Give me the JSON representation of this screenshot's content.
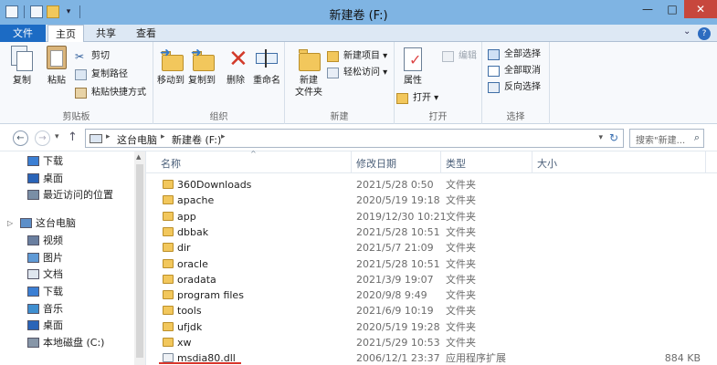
{
  "window": {
    "title": "新建卷 (F:)",
    "controls": {
      "minimize": "—",
      "maximize": "□",
      "close": "✕"
    }
  },
  "ribbon_tabs": [
    "文件",
    "主页",
    "共享",
    "查看"
  ],
  "ribbon": {
    "clipboard": {
      "label": "剪贴板",
      "copy": "复制",
      "paste": "粘贴",
      "cut": "剪切",
      "copy_path": "复制路径",
      "paste_shortcut": "粘贴快捷方式"
    },
    "organize": {
      "label": "组织",
      "move_to": "移动到",
      "copy_to": "复制到",
      "delete": "删除",
      "rename": "重命名"
    },
    "new": {
      "label": "新建",
      "new_folder_line1": "新建",
      "new_folder_line2": "文件夹",
      "new_item": "新建项目",
      "easy_access": "轻松访问"
    },
    "open": {
      "label": "打开",
      "properties": "属性",
      "open": "打开",
      "edit": "编辑"
    },
    "select": {
      "label": "选择",
      "select_all": "全部选择",
      "select_none": "全部取消",
      "invert": "反向选择"
    }
  },
  "address": {
    "crumbs": [
      "这台电脑",
      "新建卷 (F:)"
    ],
    "search_placeholder": "搜索\"新建...",
    "nav": {
      "back": "←",
      "forward": "→",
      "up": "↑"
    }
  },
  "nav_pane": [
    {
      "label": "下载",
      "icon": "download-icon",
      "indent": 1
    },
    {
      "label": "桌面",
      "icon": "desktop-icon",
      "indent": 1
    },
    {
      "label": "最近访问的位置",
      "icon": "recent-icon",
      "indent": 1
    },
    {
      "label": "这台电脑",
      "icon": "computer-icon",
      "indent": 0
    },
    {
      "label": "视频",
      "icon": "video-icon",
      "indent": 1
    },
    {
      "label": "图片",
      "icon": "pictures-icon",
      "indent": 1
    },
    {
      "label": "文档",
      "icon": "documents-icon",
      "indent": 1
    },
    {
      "label": "下载",
      "icon": "download-icon",
      "indent": 1
    },
    {
      "label": "音乐",
      "icon": "music-icon",
      "indent": 1
    },
    {
      "label": "桌面",
      "icon": "desktop-icon",
      "indent": 1
    },
    {
      "label": "本地磁盘 (C:)",
      "icon": "drive-icon",
      "indent": 1
    }
  ],
  "columns": {
    "name": "名称",
    "modified": "修改日期",
    "type": "类型",
    "size": "大小"
  },
  "files": [
    {
      "name": "360Downloads",
      "modified": "2021/5/28 0:50",
      "type": "文件夹",
      "size": "",
      "kind": "folder"
    },
    {
      "name": "apache",
      "modified": "2020/5/19 19:18",
      "type": "文件夹",
      "size": "",
      "kind": "folder"
    },
    {
      "name": "app",
      "modified": "2019/12/30 10:21",
      "type": "文件夹",
      "size": "",
      "kind": "folder"
    },
    {
      "name": "dbbak",
      "modified": "2021/5/28 10:51",
      "type": "文件夹",
      "size": "",
      "kind": "folder"
    },
    {
      "name": "dir",
      "modified": "2021/5/7 21:09",
      "type": "文件夹",
      "size": "",
      "kind": "folder"
    },
    {
      "name": "oracle",
      "modified": "2021/5/28 10:51",
      "type": "文件夹",
      "size": "",
      "kind": "folder"
    },
    {
      "name": "oradata",
      "modified": "2021/3/9 19:07",
      "type": "文件夹",
      "size": "",
      "kind": "folder"
    },
    {
      "name": "program files",
      "modified": "2020/9/8 9:49",
      "type": "文件夹",
      "size": "",
      "kind": "folder"
    },
    {
      "name": "tools",
      "modified": "2021/6/9 10:19",
      "type": "文件夹",
      "size": "",
      "kind": "folder"
    },
    {
      "name": "ufjdk",
      "modified": "2020/5/19 19:28",
      "type": "文件夹",
      "size": "",
      "kind": "folder"
    },
    {
      "name": "xw",
      "modified": "2021/5/29 10:53",
      "type": "文件夹",
      "size": "",
      "kind": "folder"
    },
    {
      "name": "msdia80.dll",
      "modified": "2006/12/1 23:37",
      "type": "应用程序扩展",
      "size": "884 KB",
      "kind": "dll"
    }
  ]
}
